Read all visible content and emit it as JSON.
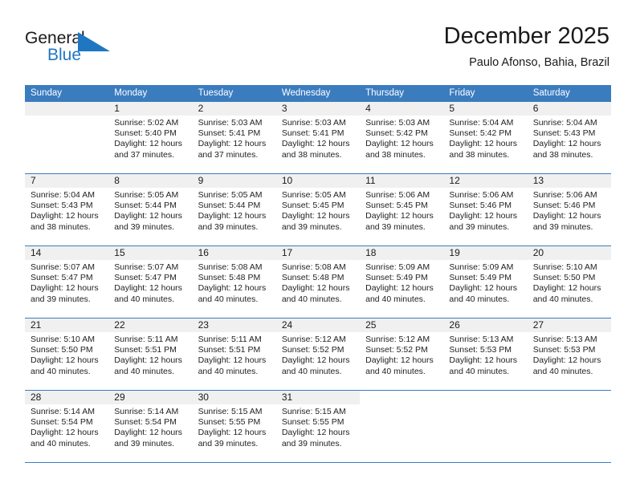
{
  "brand": {
    "name_part1": "General",
    "name_part2": "Blue",
    "triangle_color": "#1f77c2"
  },
  "header": {
    "title": "December 2025",
    "location": "Paulo Afonso, Bahia, Brazil"
  },
  "theme": {
    "header_blue": "#3b7cbf",
    "daynum_band": "#f0f0f0",
    "text": "#1a1a1a"
  },
  "weekdays": [
    "Sunday",
    "Monday",
    "Tuesday",
    "Wednesday",
    "Thursday",
    "Friday",
    "Saturday"
  ],
  "weeks": [
    [
      {
        "day": "",
        "lines": []
      },
      {
        "day": "1",
        "lines": [
          "Sunrise: 5:02 AM",
          "Sunset: 5:40 PM",
          "Daylight: 12 hours",
          "and 37 minutes."
        ]
      },
      {
        "day": "2",
        "lines": [
          "Sunrise: 5:03 AM",
          "Sunset: 5:41 PM",
          "Daylight: 12 hours",
          "and 37 minutes."
        ]
      },
      {
        "day": "3",
        "lines": [
          "Sunrise: 5:03 AM",
          "Sunset: 5:41 PM",
          "Daylight: 12 hours",
          "and 38 minutes."
        ]
      },
      {
        "day": "4",
        "lines": [
          "Sunrise: 5:03 AM",
          "Sunset: 5:42 PM",
          "Daylight: 12 hours",
          "and 38 minutes."
        ]
      },
      {
        "day": "5",
        "lines": [
          "Sunrise: 5:04 AM",
          "Sunset: 5:42 PM",
          "Daylight: 12 hours",
          "and 38 minutes."
        ]
      },
      {
        "day": "6",
        "lines": [
          "Sunrise: 5:04 AM",
          "Sunset: 5:43 PM",
          "Daylight: 12 hours",
          "and 38 minutes."
        ]
      }
    ],
    [
      {
        "day": "7",
        "lines": [
          "Sunrise: 5:04 AM",
          "Sunset: 5:43 PM",
          "Daylight: 12 hours",
          "and 38 minutes."
        ]
      },
      {
        "day": "8",
        "lines": [
          "Sunrise: 5:05 AM",
          "Sunset: 5:44 PM",
          "Daylight: 12 hours",
          "and 39 minutes."
        ]
      },
      {
        "day": "9",
        "lines": [
          "Sunrise: 5:05 AM",
          "Sunset: 5:44 PM",
          "Daylight: 12 hours",
          "and 39 minutes."
        ]
      },
      {
        "day": "10",
        "lines": [
          "Sunrise: 5:05 AM",
          "Sunset: 5:45 PM",
          "Daylight: 12 hours",
          "and 39 minutes."
        ]
      },
      {
        "day": "11",
        "lines": [
          "Sunrise: 5:06 AM",
          "Sunset: 5:45 PM",
          "Daylight: 12 hours",
          "and 39 minutes."
        ]
      },
      {
        "day": "12",
        "lines": [
          "Sunrise: 5:06 AM",
          "Sunset: 5:46 PM",
          "Daylight: 12 hours",
          "and 39 minutes."
        ]
      },
      {
        "day": "13",
        "lines": [
          "Sunrise: 5:06 AM",
          "Sunset: 5:46 PM",
          "Daylight: 12 hours",
          "and 39 minutes."
        ]
      }
    ],
    [
      {
        "day": "14",
        "lines": [
          "Sunrise: 5:07 AM",
          "Sunset: 5:47 PM",
          "Daylight: 12 hours",
          "and 39 minutes."
        ]
      },
      {
        "day": "15",
        "lines": [
          "Sunrise: 5:07 AM",
          "Sunset: 5:47 PM",
          "Daylight: 12 hours",
          "and 40 minutes."
        ]
      },
      {
        "day": "16",
        "lines": [
          "Sunrise: 5:08 AM",
          "Sunset: 5:48 PM",
          "Daylight: 12 hours",
          "and 40 minutes."
        ]
      },
      {
        "day": "17",
        "lines": [
          "Sunrise: 5:08 AM",
          "Sunset: 5:48 PM",
          "Daylight: 12 hours",
          "and 40 minutes."
        ]
      },
      {
        "day": "18",
        "lines": [
          "Sunrise: 5:09 AM",
          "Sunset: 5:49 PM",
          "Daylight: 12 hours",
          "and 40 minutes."
        ]
      },
      {
        "day": "19",
        "lines": [
          "Sunrise: 5:09 AM",
          "Sunset: 5:49 PM",
          "Daylight: 12 hours",
          "and 40 minutes."
        ]
      },
      {
        "day": "20",
        "lines": [
          "Sunrise: 5:10 AM",
          "Sunset: 5:50 PM",
          "Daylight: 12 hours",
          "and 40 minutes."
        ]
      }
    ],
    [
      {
        "day": "21",
        "lines": [
          "Sunrise: 5:10 AM",
          "Sunset: 5:50 PM",
          "Daylight: 12 hours",
          "and 40 minutes."
        ]
      },
      {
        "day": "22",
        "lines": [
          "Sunrise: 5:11 AM",
          "Sunset: 5:51 PM",
          "Daylight: 12 hours",
          "and 40 minutes."
        ]
      },
      {
        "day": "23",
        "lines": [
          "Sunrise: 5:11 AM",
          "Sunset: 5:51 PM",
          "Daylight: 12 hours",
          "and 40 minutes."
        ]
      },
      {
        "day": "24",
        "lines": [
          "Sunrise: 5:12 AM",
          "Sunset: 5:52 PM",
          "Daylight: 12 hours",
          "and 40 minutes."
        ]
      },
      {
        "day": "25",
        "lines": [
          "Sunrise: 5:12 AM",
          "Sunset: 5:52 PM",
          "Daylight: 12 hours",
          "and 40 minutes."
        ]
      },
      {
        "day": "26",
        "lines": [
          "Sunrise: 5:13 AM",
          "Sunset: 5:53 PM",
          "Daylight: 12 hours",
          "and 40 minutes."
        ]
      },
      {
        "day": "27",
        "lines": [
          "Sunrise: 5:13 AM",
          "Sunset: 5:53 PM",
          "Daylight: 12 hours",
          "and 40 minutes."
        ]
      }
    ],
    [
      {
        "day": "28",
        "lines": [
          "Sunrise: 5:14 AM",
          "Sunset: 5:54 PM",
          "Daylight: 12 hours",
          "and 40 minutes."
        ]
      },
      {
        "day": "29",
        "lines": [
          "Sunrise: 5:14 AM",
          "Sunset: 5:54 PM",
          "Daylight: 12 hours",
          "and 39 minutes."
        ]
      },
      {
        "day": "30",
        "lines": [
          "Sunrise: 5:15 AM",
          "Sunset: 5:55 PM",
          "Daylight: 12 hours",
          "and 39 minutes."
        ]
      },
      {
        "day": "31",
        "lines": [
          "Sunrise: 5:15 AM",
          "Sunset: 5:55 PM",
          "Daylight: 12 hours",
          "and 39 minutes."
        ]
      },
      {
        "day": "",
        "lines": []
      },
      {
        "day": "",
        "lines": []
      },
      {
        "day": "",
        "lines": []
      }
    ]
  ]
}
